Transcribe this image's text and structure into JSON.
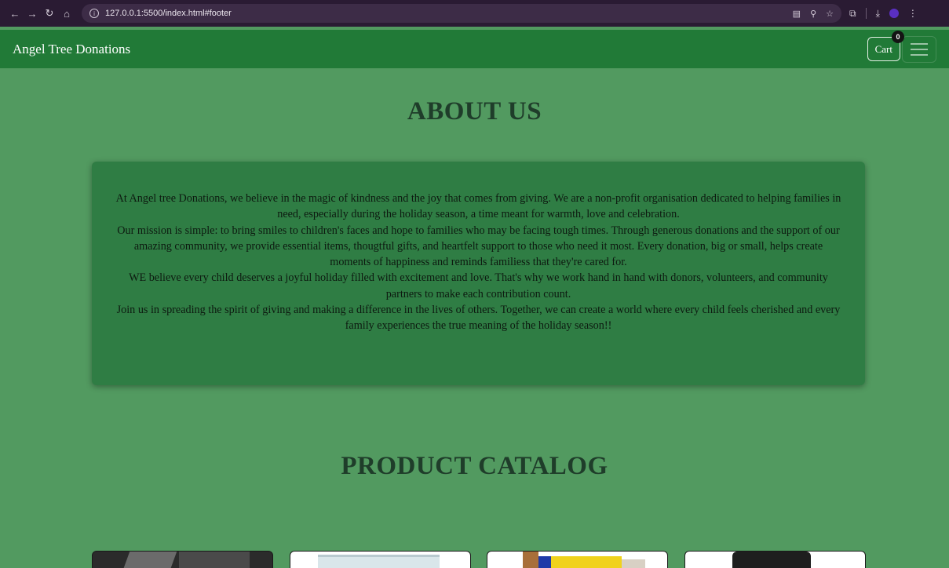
{
  "browser": {
    "url": "127.0.0.1:5500/index.html#footer"
  },
  "navbar": {
    "brand": "Angel Tree Donations",
    "cart_label": "Cart",
    "cart_count": "0"
  },
  "about": {
    "heading": "ABOUT US",
    "paragraphs": [
      "At Angel tree Donations, we believe in the magic of kindness and the joy that comes from giving. We are a non-profit organisation dedicated to helping families in need, especially during the holiday season, a time meant for warmth, love and celebration.",
      "Our mission is simple: to bring smiles to children's faces and hope to families who may be facing tough times. Through generous donations and the support of our amazing community, we provide essential items, thougtful gifts, and heartfelt support to those who need it most. Every donation, big or small, helps create moments of happiness and reminds familiess that they're cared for.",
      "WE believe every child deserves a joyful holiday filled with excitement and love. That's why we work hand in hand with donors, volunteers, and community partners to make each contribution count.",
      "Join us in spreading the spirit of giving and making a difference in the lives of others. Together, we can create a world where every child feels cherished and every family experiences the true meaning of the holiday season!!"
    ]
  },
  "catalog": {
    "heading": "PRODUCT CATALOG"
  },
  "colors": {
    "page_bg": "#529a60",
    "navbar_bg": "#217a37",
    "about_box_bg": "#2f7d44",
    "heading_color": "#1f3d2a"
  }
}
